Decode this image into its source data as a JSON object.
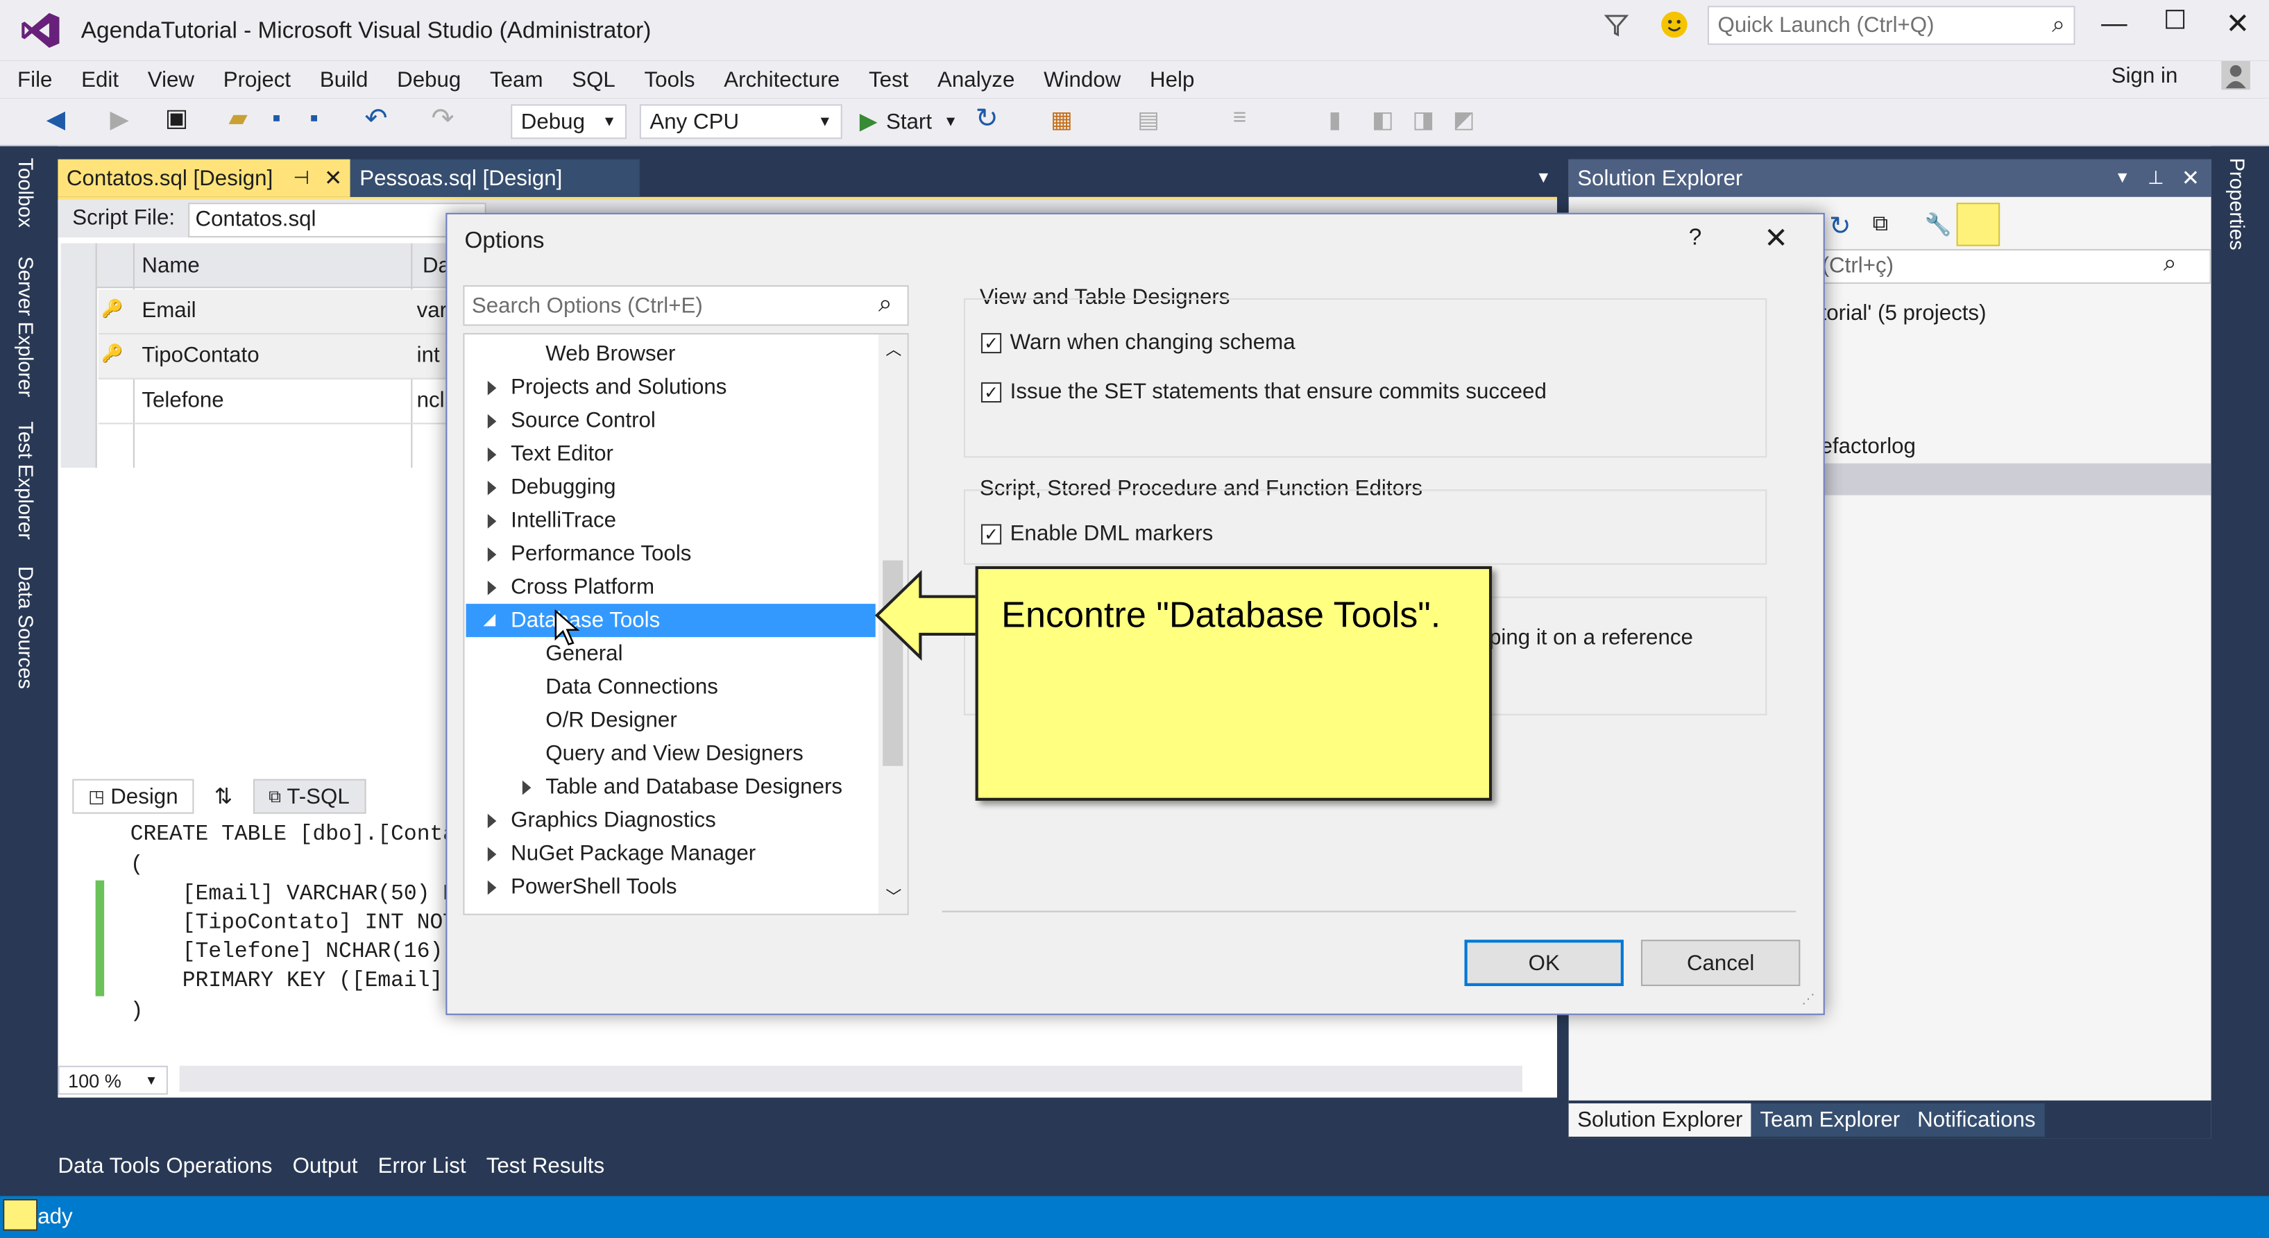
{
  "window": {
    "title": "AgendaTutorial - Microsoft Visual Studio (Administrator)",
    "quick_launch_placeholder": "Quick Launch (Ctrl+Q)",
    "sign_in": "Sign in"
  },
  "menu": [
    "File",
    "Edit",
    "View",
    "Project",
    "Build",
    "Debug",
    "Team",
    "SQL",
    "Tools",
    "Architecture",
    "Test",
    "Analyze",
    "Window",
    "Help"
  ],
  "toolbar": {
    "config": "Debug",
    "platform": "Any CPU",
    "start": "Start"
  },
  "side_tabs_left": [
    "Toolbox",
    "Server Explorer",
    "Test Explorer",
    "Data Sources"
  ],
  "side_tabs_right": [
    "Properties"
  ],
  "doc_tabs": [
    {
      "label": "Contatos.sql [Design]",
      "active": true
    },
    {
      "label": "Pessoas.sql [Design]",
      "active": false
    }
  ],
  "designer": {
    "script_file_label": "Script File:",
    "script_file_value": "Contatos.sql",
    "columns": [
      "Name",
      "Da"
    ],
    "rows": [
      {
        "name": "Email",
        "type": "var",
        "key": true
      },
      {
        "name": "TipoContato",
        "type": "int",
        "key": true
      },
      {
        "name": "Telefone",
        "type": "ncl",
        "key": false
      }
    ],
    "pane_tabs": [
      "Design",
      "T-SQL"
    ],
    "code_lines": [
      "CREATE TABLE [dbo].[Conta",
      "(",
      "    [Email] VARCHAR(50) N",
      "    [TipoContato] INT NOT",
      "    [Telefone] NCHAR(16)",
      "    PRIMARY KEY ([Email],",
      ")"
    ],
    "zoom": "100 %"
  },
  "solution_explorer": {
    "title": "Solution Explorer",
    "search_hint": "(Ctrl+ç)",
    "items": [
      "torial' (5 projects)",
      "efactorlog"
    ],
    "bottom_tabs": [
      "Solution Explorer",
      "Team Explorer",
      "Notifications"
    ]
  },
  "bottom_tabs": [
    "Data Tools Operations",
    "Output",
    "Error List",
    "Test Results"
  ],
  "status": "ady",
  "dialog": {
    "title": "Options",
    "help": "?",
    "search_placeholder": "Search Options (Ctrl+E)",
    "tree": [
      {
        "label": "Web Browser",
        "level": 1,
        "expander": "none"
      },
      {
        "label": "Projects and Solutions",
        "level": 0,
        "expander": "collapsed"
      },
      {
        "label": "Source Control",
        "level": 0,
        "expander": "collapsed"
      },
      {
        "label": "Text Editor",
        "level": 0,
        "expander": "collapsed"
      },
      {
        "label": "Debugging",
        "level": 0,
        "expander": "collapsed"
      },
      {
        "label": "IntelliTrace",
        "level": 0,
        "expander": "collapsed"
      },
      {
        "label": "Performance Tools",
        "level": 0,
        "expander": "collapsed"
      },
      {
        "label": "Cross Platform",
        "level": 0,
        "expander": "collapsed"
      },
      {
        "label": "Database Tools",
        "level": 0,
        "expander": "expanded",
        "selected": true
      },
      {
        "label": "General",
        "level": 1,
        "expander": "none"
      },
      {
        "label": "Data Connections",
        "level": 1,
        "expander": "none"
      },
      {
        "label": "O/R Designer",
        "level": 1,
        "expander": "none"
      },
      {
        "label": "Query and View Designers",
        "level": 1,
        "expander": "none"
      },
      {
        "label": "Table and Database Designers",
        "level": 1,
        "expander": "collapsed"
      },
      {
        "label": "Graphics Diagnostics",
        "level": 0,
        "expander": "collapsed"
      },
      {
        "label": "NuGet Package Manager",
        "level": 0,
        "expander": "collapsed"
      },
      {
        "label": "PowerShell Tools",
        "level": 0,
        "expander": "collapsed"
      }
    ],
    "groups": [
      {
        "title": "View and Table Designers",
        "options": [
          {
            "label": "Warn when changing schema",
            "checked": true
          },
          {
            "label": "Issue the SET statements that ensure commits succeed",
            "checked": true
          }
        ]
      },
      {
        "title": "Script, Stored Procedure and Function Editors",
        "options": [
          {
            "label": "Enable DML markers",
            "checked": true
          }
        ]
      }
    ],
    "partial_text": "ping it on a reference",
    "ok": "OK",
    "cancel": "Cancel"
  },
  "callout": {
    "text": "Encontre \"Database Tools\"."
  }
}
